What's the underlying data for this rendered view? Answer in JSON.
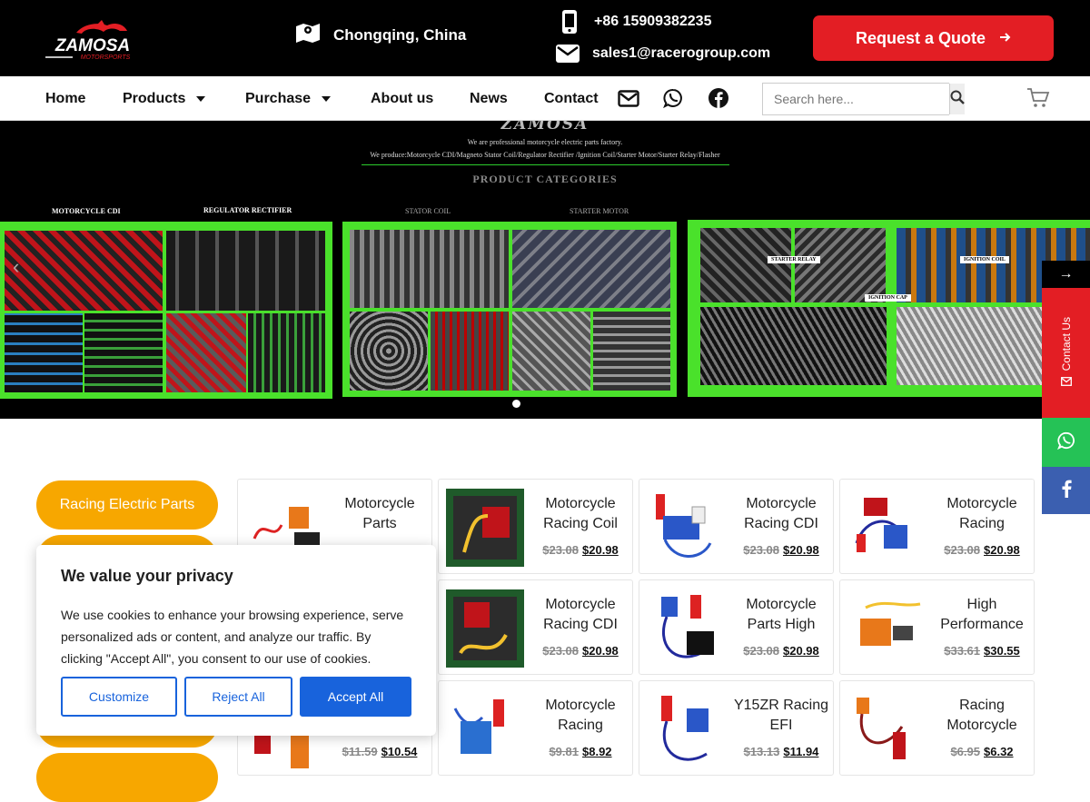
{
  "header": {
    "logo_text": "ZAMOSA",
    "logo_sub": "MOTORSPORTS",
    "location": "Chongqing, China",
    "phone": "+86 15909382235",
    "email": "sales1@racerogroup.com",
    "quote_button": "Request a Quote",
    "accent_color": "#e31e24"
  },
  "nav": {
    "items": [
      {
        "label": "Home",
        "dropdown": false
      },
      {
        "label": "Products",
        "dropdown": true
      },
      {
        "label": "Purchase",
        "dropdown": true
      },
      {
        "label": "About us",
        "dropdown": false
      },
      {
        "label": "News",
        "dropdown": false
      },
      {
        "label": "Contact",
        "dropdown": false
      }
    ],
    "icons": [
      "envelope-icon",
      "whatsapp-icon",
      "facebook-icon"
    ],
    "search_placeholder": "Search here...",
    "cart_icon": "cart-icon"
  },
  "hero": {
    "brand": "ZAMOSA",
    "tagline1": "We are professional motorcycle electric parts factory.",
    "tagline2": "We produce:Motorcycle CDI/Magneto Stator Coil/Regulator Rectifier /Ignition Coil/Starter Motor/Starter Relay/Flasher",
    "categories_title": "PRODUCT CATEGORIES",
    "panel_labels": [
      "MOTORCYCLE CDI",
      "REGULATOR RECTIFIER",
      "STATOR COIL",
      "STARTER MOTOR"
    ],
    "tile_labels": [
      "STARTER RELAY",
      "IGNITION COIL",
      "IGNITION CAP"
    ],
    "panel_color": "#4ae12b"
  },
  "floating": {
    "contact_label": "Contact Us",
    "arrow": "→"
  },
  "sidebar": {
    "categories": [
      "Racing Electric Parts"
    ],
    "button_color": "#f7a700"
  },
  "products": [
    {
      "title": "Motorcycle Parts",
      "old_price": "",
      "price": ""
    },
    {
      "title": "Motorcycle Racing Coil",
      "old_price": "$23.08",
      "price": "$20.98"
    },
    {
      "title": "Motorcycle Racing CDI",
      "old_price": "$23.08",
      "price": "$20.98"
    },
    {
      "title": "Motorcycle Racing",
      "old_price": "$23.08",
      "price": "$20.98"
    },
    {
      "title": "Motorcycle Racing CDI",
      "old_price": "$23.08",
      "price": "$20.98"
    },
    {
      "title": "Motorcycle Parts High",
      "old_price": "$23.08",
      "price": "$20.98"
    },
    {
      "title": "High Performance",
      "old_price": "$33.61",
      "price": "$30.55"
    },
    {
      "title": "",
      "old_price": "$11.59",
      "price": "$10.54"
    },
    {
      "title": "Motorcycle Racing",
      "old_price": "$9.81",
      "price": "$8.92"
    },
    {
      "title": "Y15ZR Racing EFI",
      "old_price": "$13.13",
      "price": "$11.94"
    },
    {
      "title": "Racing Motorcycle",
      "old_price": "$6.95",
      "price": "$6.32"
    }
  ],
  "privacy": {
    "title": "We value your privacy",
    "body": "We use cookies to enhance your browsing experience, serve personalized ads or content, and analyze our traffic. By clicking \"Accept All\", you consent to our use of cookies.",
    "customize": "Customize",
    "reject": "Reject All",
    "accept": "Accept All"
  }
}
